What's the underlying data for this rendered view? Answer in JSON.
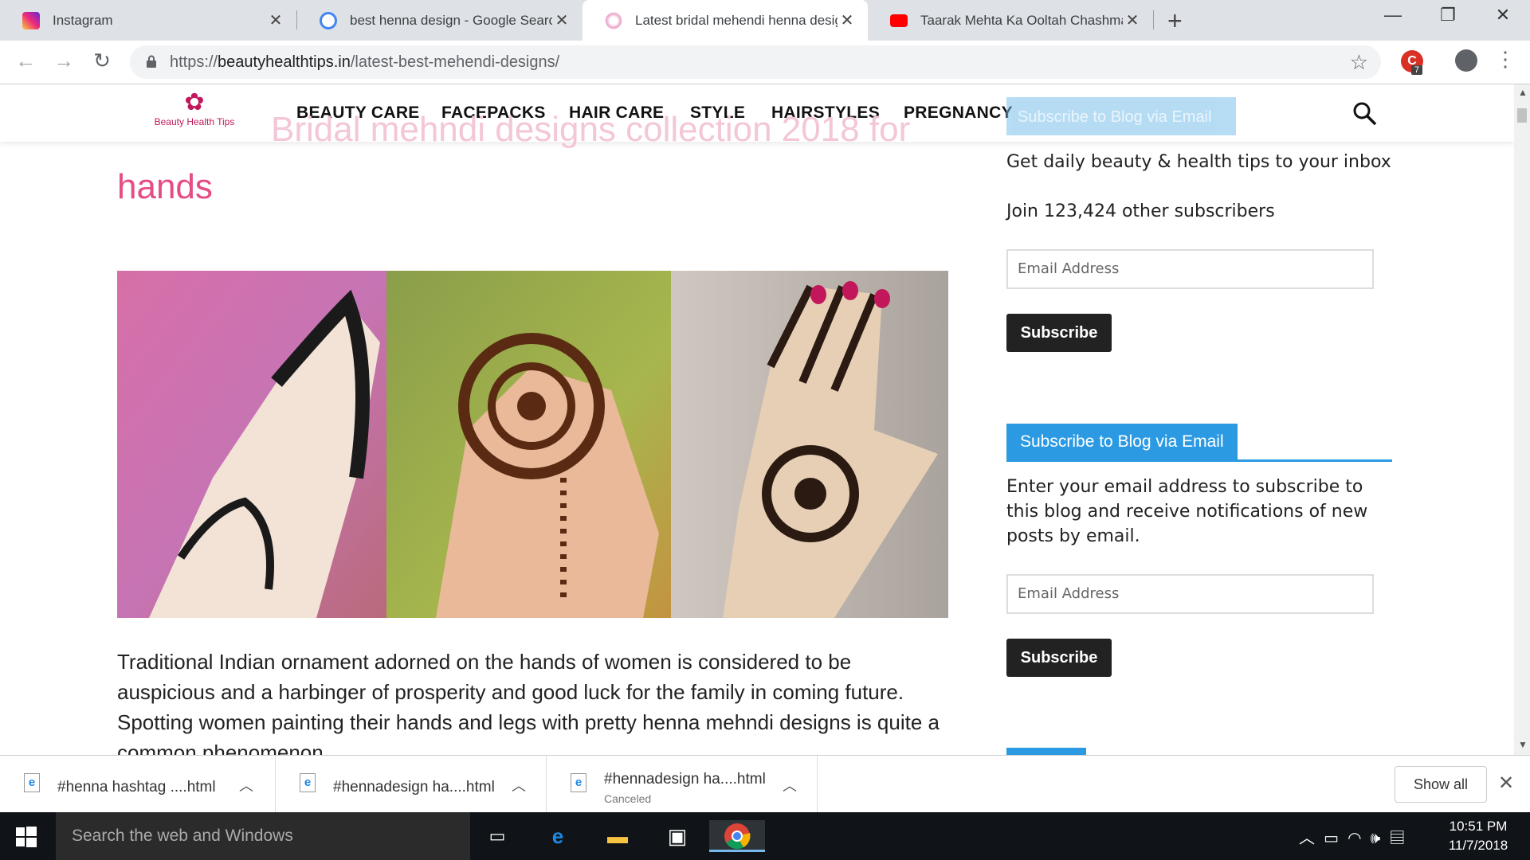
{
  "browser": {
    "tabs": [
      {
        "title": "Instagram",
        "favicon_color": "#c13584",
        "active": false
      },
      {
        "title": "best henna design - Google Search",
        "favicon_color": "#4285f4",
        "active": false
      },
      {
        "title": "Latest bridal mehendi henna designs",
        "favicon_color": "#e9a0c8",
        "active": true
      },
      {
        "title": "Taarak Mehta Ka Ooltah Chashmah",
        "favicon_color": "#ff0000",
        "active": false
      }
    ],
    "url_prefix": "https://",
    "url_domain": "beautyhealthtips.in",
    "url_path": "/latest-best-mehendi-designs/",
    "extension_badge": "7"
  },
  "site": {
    "logo_text": "Beauty Health Tips",
    "nav": [
      "BEAUTY CARE",
      "FACEPACKS",
      "HAIR CARE",
      "STYLE",
      "HAIRSTYLES",
      "PREGNANCY"
    ],
    "ghost_title": "Bridal mehndi designs collection 2018 for",
    "ghost_widget": "Subscribe to Blog via Email",
    "post_title_tail": "hands",
    "body_text": "Traditional Indian ornament adorned on the hands of women is considered to be auspicious and a harbinger of prosperity and good luck for the family in coming future. Spotting women painting their hands and legs with pretty henna mehndi designs is quite a common phenomenon."
  },
  "sidebar": {
    "tagline": "Get daily beauty & health tips to your inbox",
    "subscribers": "Join 123,424 other subscribers",
    "email_placeholder": "Email Address",
    "subscribe_label": "Subscribe",
    "widget_title": "Subscribe to Blog via Email",
    "widget_text": "Enter your email address to subscribe to this blog and receive notifications of new posts by email.",
    "email_placeholder_2": "Email Address",
    "subscribe_label_2": "Subscribe"
  },
  "downloads": {
    "items": [
      {
        "name": "#henna hashtag ....html",
        "status": ""
      },
      {
        "name": "#hennadesign ha....html",
        "status": ""
      },
      {
        "name": "#hennadesign ha....html",
        "status": "Canceled"
      }
    ],
    "show_all": "Show all"
  },
  "taskbar": {
    "search_placeholder": "Search the web and Windows",
    "time": "10:51 PM",
    "date": "11/7/2018"
  },
  "colors": {
    "accent_pink": "#e64c85",
    "widget_blue": "#2c9ae3",
    "button_dark": "#222222"
  }
}
